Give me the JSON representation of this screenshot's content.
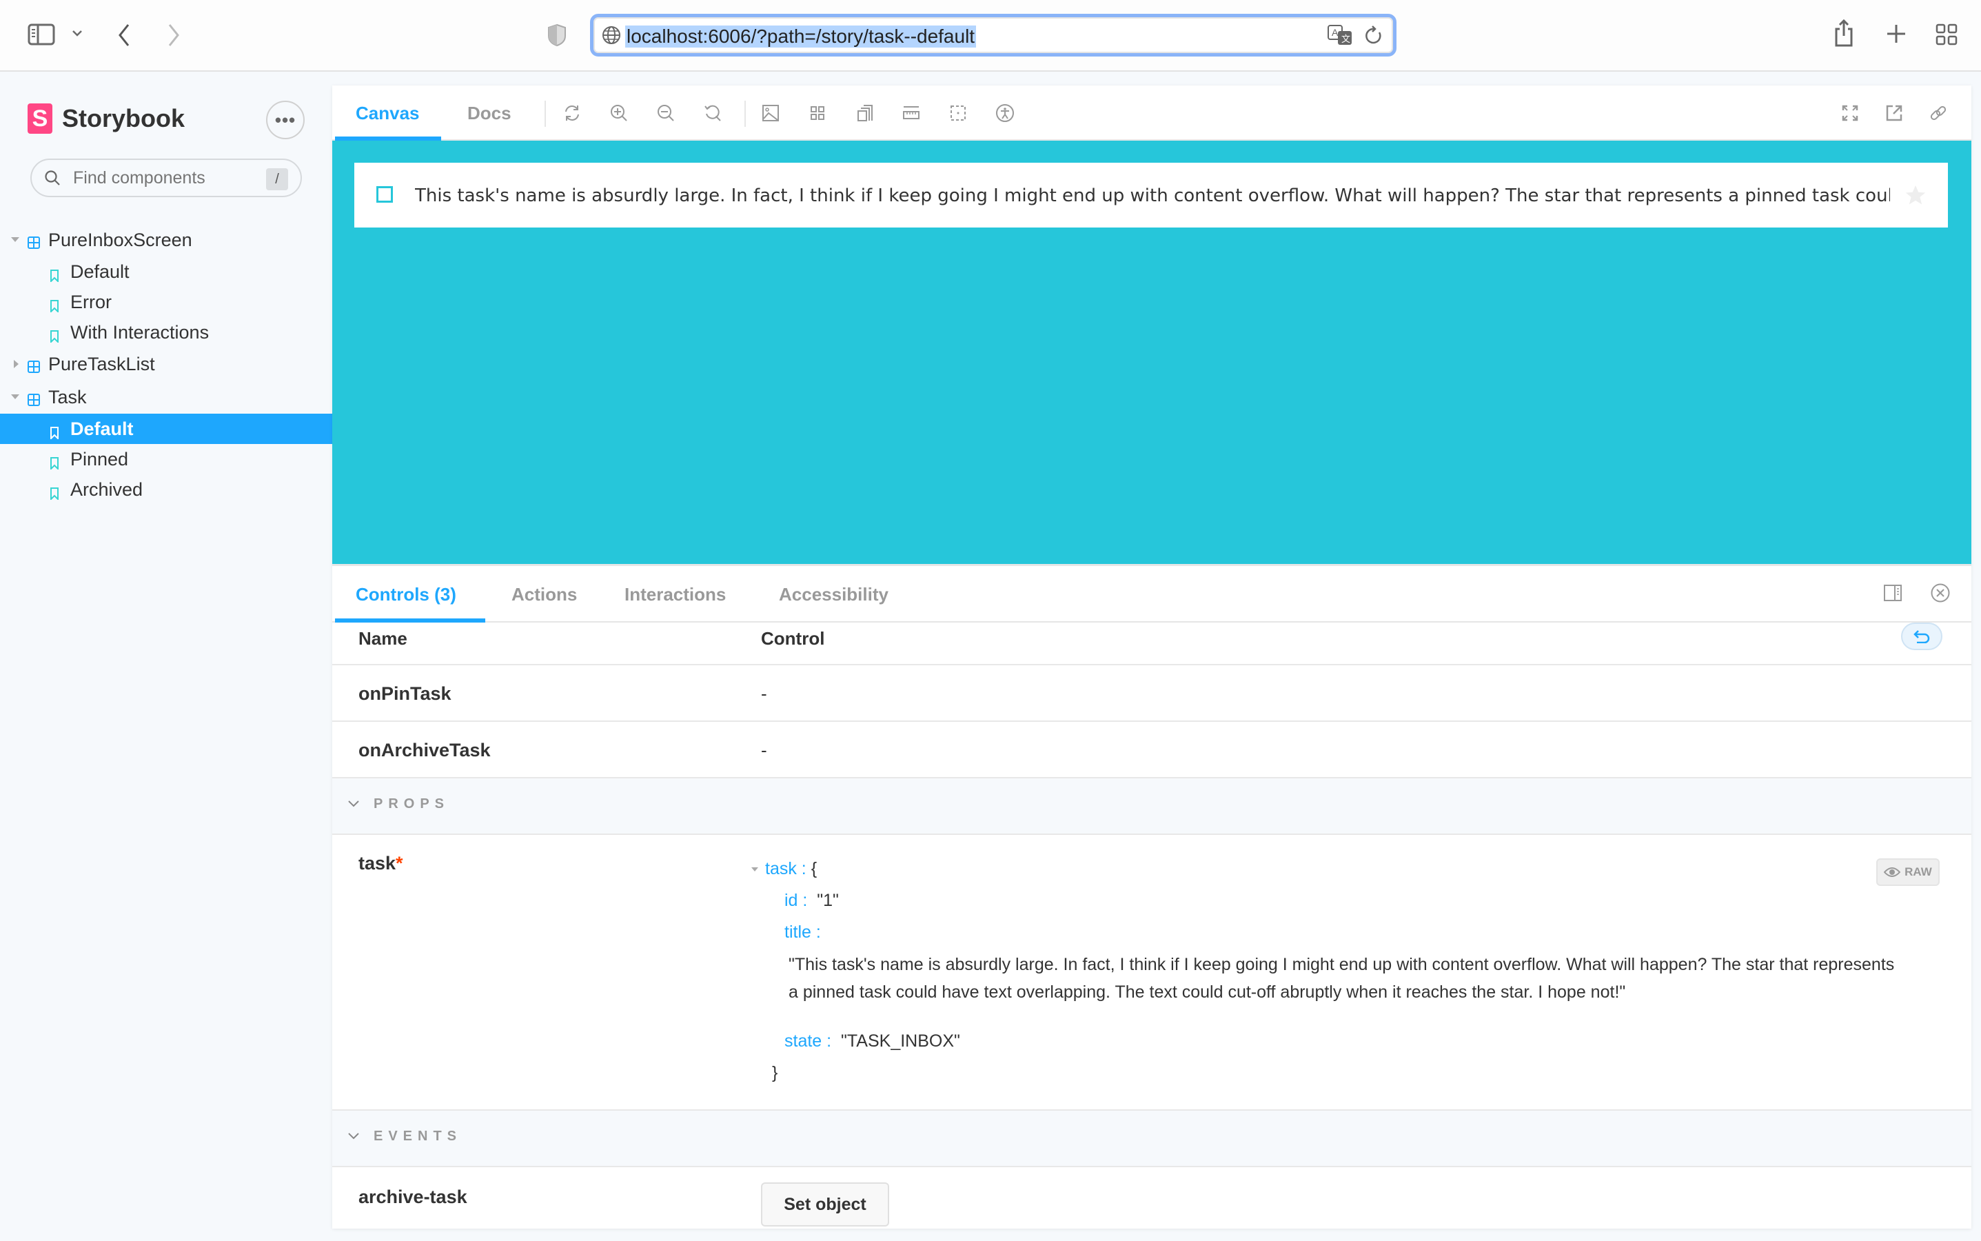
{
  "browser": {
    "url": "localhost:6006/?path=/story/task--default",
    "icons": [
      "sidebar-toggle-icon",
      "chevron-down-icon",
      "back-icon",
      "forward-icon",
      "privacy-shield-icon",
      "globe-icon",
      "translate-icon",
      "reload-icon",
      "share-icon",
      "new-tab-icon",
      "tab-overview-icon"
    ]
  },
  "sidebar": {
    "brand": "Storybook",
    "logo_letter": "S",
    "menu_label": "•••",
    "search": {
      "placeholder": "Find components",
      "shortcut": "/"
    },
    "tree": [
      {
        "type": "component",
        "label": "PureInboxScreen",
        "expanded": true,
        "stories": [
          {
            "label": "Default"
          },
          {
            "label": "Error"
          },
          {
            "label": "With Interactions"
          }
        ]
      },
      {
        "type": "component",
        "label": "PureTaskList",
        "expanded": false,
        "stories": []
      },
      {
        "type": "component",
        "label": "Task",
        "expanded": true,
        "stories": [
          {
            "label": "Default",
            "selected": true
          },
          {
            "label": "Pinned"
          },
          {
            "label": "Archived"
          }
        ]
      }
    ]
  },
  "toolbar": {
    "tabs": [
      {
        "label": "Canvas",
        "active": true
      },
      {
        "label": "Docs",
        "active": false
      }
    ],
    "tools": [
      "remount-icon",
      "zoom-in-icon",
      "zoom-out-icon",
      "zoom-reset-icon",
      "background-icon",
      "grid-icon",
      "viewport-icon",
      "measure-icon",
      "outline-icon",
      "accessibility-icon"
    ],
    "right_tools": [
      "fullscreen-icon",
      "open-new-tab-icon",
      "copy-link-icon"
    ]
  },
  "canvas": {
    "background": "#26c6da",
    "task": {
      "title": "This task's name is absurdly large. In fact, I think if I keep going I might end up with content overflow. What will happen? The star that represents a pinned task could have text overlapping. The text could cut-off abruptly when it reaches the star. I hope not!",
      "checked": false,
      "pinned": false
    }
  },
  "addons": {
    "tabs": [
      {
        "label": "Controls (3)",
        "active": true
      },
      {
        "label": "Actions",
        "active": false
      },
      {
        "label": "Interactions",
        "active": false
      },
      {
        "label": "Accessibility",
        "active": false
      }
    ],
    "table": {
      "headers": {
        "name": "Name",
        "control": "Control"
      },
      "rows": [
        {
          "name": "onPinTask",
          "control": "-"
        },
        {
          "name": "onArchiveTask",
          "control": "-"
        }
      ],
      "sections": {
        "props": {
          "label": "PROPS",
          "task": {
            "name": "task",
            "required_mark": "*",
            "root_key": "task :",
            "open_brace": "{",
            "close_brace": "}",
            "id_key": "id :",
            "id_value": "\"1\"",
            "title_key": "title :",
            "title_value": "\"This task's name is absurdly large. In fact, I think if I keep going I might end up with content overflow. What will happen? The star that represents a pinned task could have text overlapping. The text could cut-off abruptly when it reaches the star. I hope not!\"",
            "state_key": "state :",
            "state_value": "\"TASK_INBOX\"",
            "raw_label": "RAW"
          }
        },
        "events": {
          "label": "EVENTS",
          "rows": [
            {
              "name": "archive-task",
              "button": "Set object"
            }
          ]
        }
      }
    }
  },
  "colors": {
    "accent": "#1ea7fd",
    "brand": "#ff4785",
    "story_icon": "#37d5d3",
    "required": "#ff4400"
  }
}
